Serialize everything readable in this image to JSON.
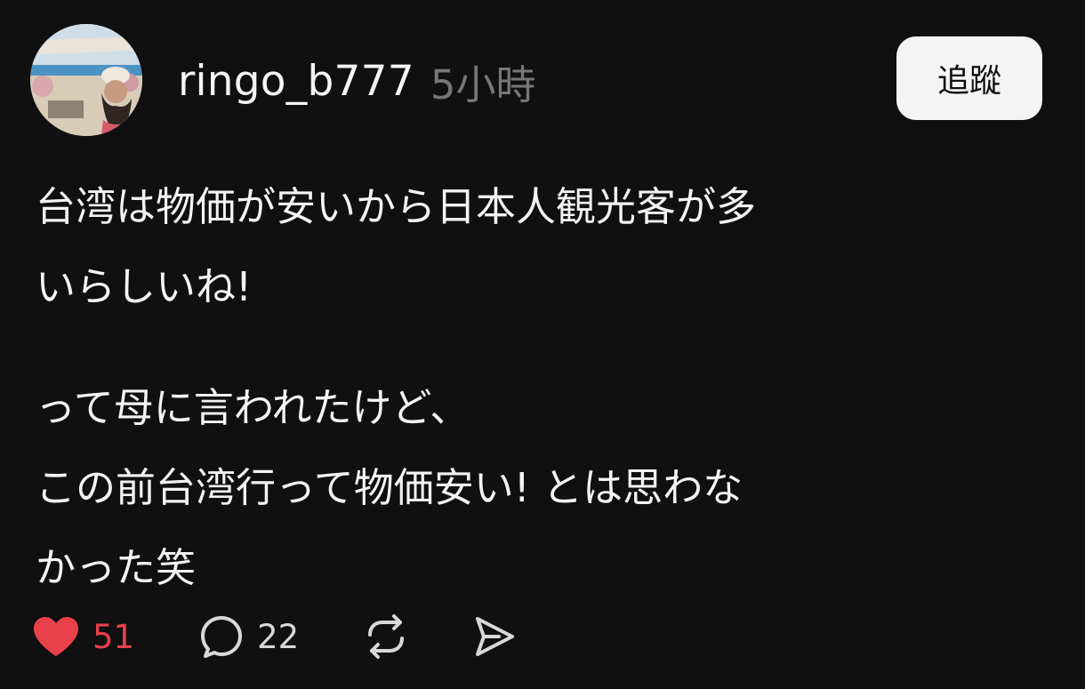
{
  "post": {
    "author": {
      "username": "ringo_b777",
      "avatar": "profile-photo-beach"
    },
    "timestamp": "5小時",
    "follow_label": "追蹤",
    "body": {
      "paragraphs": [
        [
          "台湾は物価が安いから日本人観光客が多",
          "いらしいね!"
        ],
        [
          "って母に言われたけど、",
          "この前台湾行って物価安い! とは思わな",
          "かった笑"
        ]
      ]
    },
    "actions": {
      "like": {
        "icon": "heart-icon",
        "count": "51",
        "liked": true,
        "color": "#e8414a"
      },
      "reply": {
        "icon": "comment-icon",
        "count": "22"
      },
      "repost": {
        "icon": "repost-icon"
      },
      "share": {
        "icon": "send-icon"
      }
    }
  }
}
